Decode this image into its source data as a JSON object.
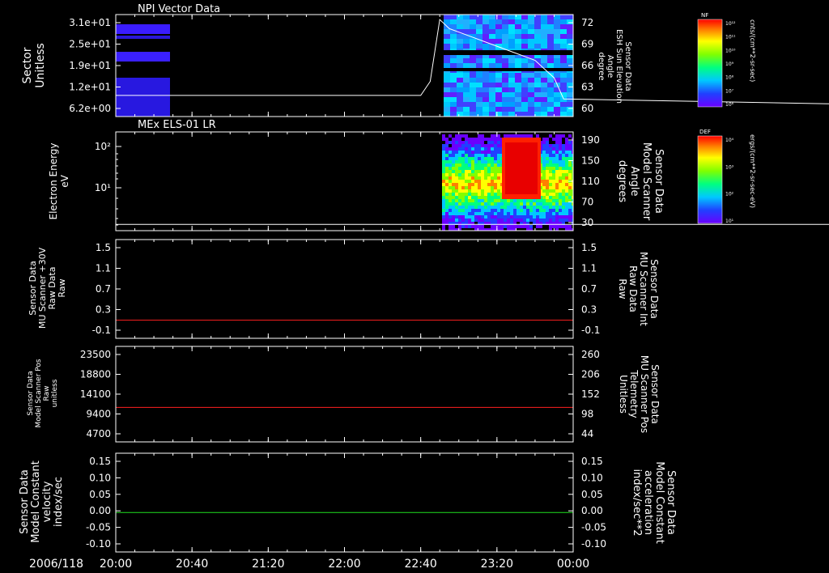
{
  "date_label": "2006/118",
  "x_ticks": [
    "20:00",
    "20:40",
    "21:20",
    "22:00",
    "22:40",
    "23:20",
    "00:00"
  ],
  "colors": {
    "bg": "#000000",
    "fg": "#ffffff",
    "red": "#ff2020",
    "green": "#20e020"
  },
  "chart_data": [
    {
      "id": "npi",
      "type": "heatmap",
      "title": "NPI Vector Data",
      "ylabel": [
        "Sector",
        "Unitless"
      ],
      "yticks": [
        "3.1e+01",
        "2.5e+01",
        "1.9e+01",
        "1.2e+01",
        "6.2e+00"
      ],
      "ylim": [
        0,
        31
      ],
      "y2label": [
        "Sensor Data",
        "ESH Sun Elevation",
        "Angle",
        "degree"
      ],
      "y2ticks": [
        "72",
        "69",
        "66",
        "63",
        "60"
      ],
      "y2lim": [
        57.5,
        72
      ],
      "colorbar": {
        "label": "NF",
        "title": "cnts/(cm**2-sr-sec)",
        "ticks": [
          "10¹²",
          "10¹¹",
          "10¹⁰",
          "10⁹",
          "10⁸",
          "10⁷",
          "10⁶"
        ]
      },
      "line_series": {
        "name": "ESH Sun Elevation Angle",
        "color": "#ffffff",
        "x": [
          "20:00",
          "22:00",
          "22:40",
          "22:45",
          "22:50",
          "22:55",
          "23:00",
          "23:20",
          "23:40",
          "23:50",
          "23:55",
          "00:00"
        ],
        "y": [
          60.5,
          60.5,
          60.5,
          62.5,
          71.3,
          70.0,
          69.5,
          67.5,
          65.5,
          63.0,
          60.0,
          58.8
        ]
      }
    },
    {
      "id": "els",
      "type": "heatmap",
      "title": "MEx ELS-01 LR",
      "ylabel": [
        "Electron Energy",
        "eV"
      ],
      "yticks": [
        "10²",
        "10¹"
      ],
      "y2label": [
        "Sensor Data",
        "Model Scanner",
        "Angle",
        "degrees"
      ],
      "y2ticks": [
        "190",
        "150",
        "110",
        "70",
        "30"
      ],
      "y2lim": [
        0,
        190
      ],
      "colorbar": {
        "label": "DEF",
        "title": "ergs/(cm**2-sr-sec-eV)",
        "ticks": [
          "10⁴",
          "10³",
          "10²",
          "10¹"
        ]
      },
      "line_series": {
        "name": "Model Scanner Angle",
        "color": "#ffffff",
        "x": [
          "20:00",
          "00:00"
        ],
        "y": [
          12,
          12
        ]
      }
    },
    {
      "id": "mu",
      "type": "line",
      "ylabel": [
        "Sensor Data",
        "MU Scanner +30V",
        "Raw Data",
        "Raw"
      ],
      "yticks": [
        "1.5",
        "1.1",
        "0.7",
        "0.3",
        "-0.1"
      ],
      "ylim": [
        -0.3,
        1.5
      ],
      "y2label": [
        "Sensor Data",
        "MU Scanner Int",
        "Raw Data",
        "Raw"
      ],
      "y2ticks": [
        "1.5",
        "1.1",
        "0.7",
        "0.3",
        "-0.1"
      ],
      "y2_color": "#ff2020",
      "series": [
        {
          "color": "#ff2020",
          "x": [
            "20:00",
            "00:00"
          ],
          "y": [
            0.03,
            0.03
          ]
        }
      ]
    },
    {
      "id": "pos",
      "type": "line",
      "ylabel": [
        "Sensor Data",
        "Model Scanner Pos",
        "Raw",
        "unitless"
      ],
      "yticks": [
        "23500",
        "18800",
        "14100",
        "9400",
        "4700"
      ],
      "ylim": [
        0,
        23500
      ],
      "y2label": [
        "Sensor Data",
        "MU Scanner Pos",
        "Telemetry",
        "Unitless"
      ],
      "y2ticks": [
        "260",
        "206",
        "152",
        "98",
        "44"
      ],
      "y2_color": "#ff2020",
      "series": [
        {
          "color": "#ff2020",
          "x": [
            "20:00",
            "00:00"
          ],
          "y": [
            8500,
            8500
          ]
        }
      ]
    },
    {
      "id": "model",
      "type": "line",
      "ylabel": [
        "Sensor Data",
        "Model Constant",
        "velocity",
        "index/sec"
      ],
      "yticks": [
        "0.15",
        "0.10",
        "0.05",
        "0.00",
        "-0.05",
        "-0.10"
      ],
      "ylim": [
        -0.1,
        0.15
      ],
      "y2label": [
        "Sensor Data",
        "Model Constant",
        "acceleration",
        "index/sec**2"
      ],
      "y2ticks": [
        "0.15",
        "0.10",
        "0.05",
        "0.00",
        "-0.05",
        "-0.10"
      ],
      "y2_color": "#20e020",
      "series": [
        {
          "color": "#20e020",
          "x": [
            "20:00",
            "00:00"
          ],
          "y": [
            0.0,
            0.0
          ]
        }
      ]
    }
  ]
}
